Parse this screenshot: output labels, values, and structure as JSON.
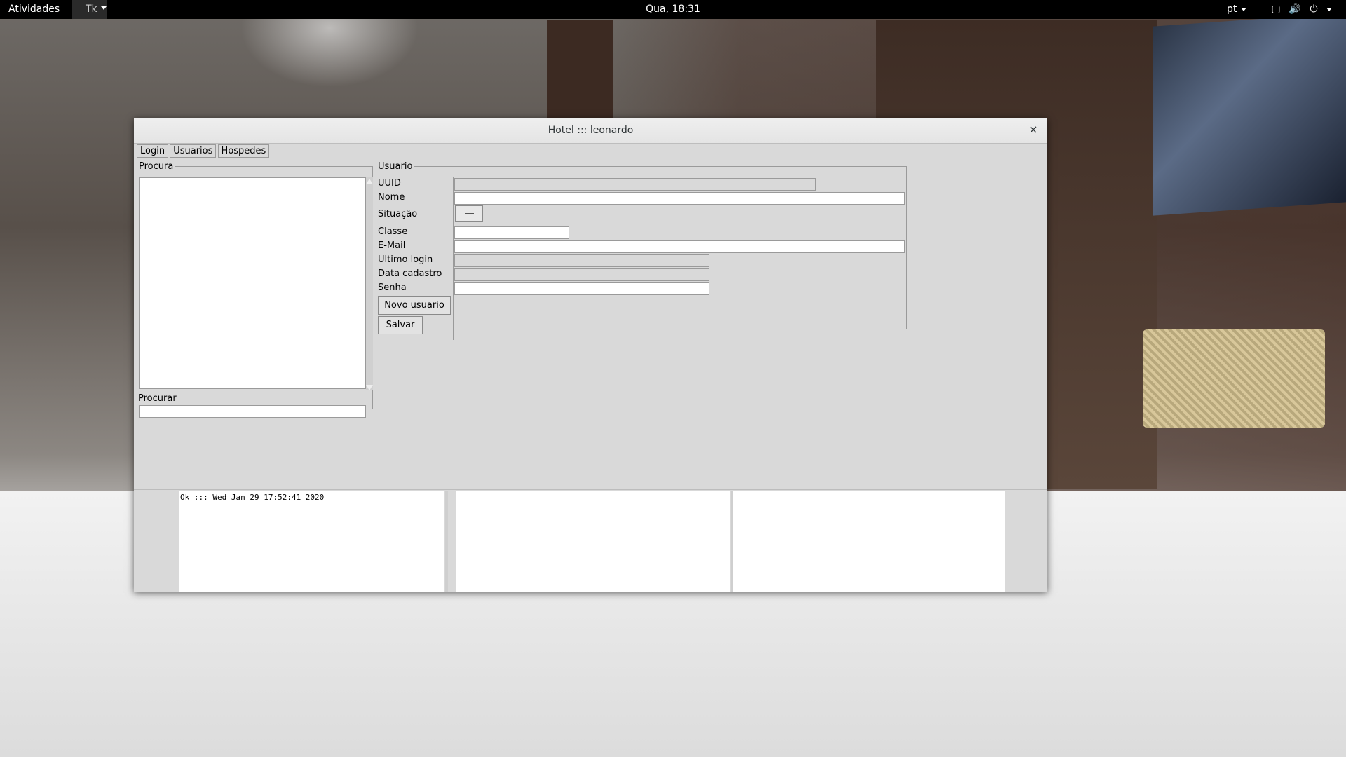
{
  "topbar": {
    "activities": "Atividades",
    "app_label": "Tk",
    "clock": "Qua, 18:31",
    "lang": "pt",
    "icons": [
      "window-icon",
      "volume-icon",
      "power-icon"
    ]
  },
  "window": {
    "title": "Hotel ::: leonardo",
    "close_glyph": "×"
  },
  "tabs": [
    "Login",
    "Usuarios",
    "Hospedes"
  ],
  "procura": {
    "legend": "Procura",
    "search_label": "Procurar",
    "search_value": ""
  },
  "usuario": {
    "legend": "Usuario",
    "fields": {
      "uuid": {
        "label": "UUID",
        "value": ""
      },
      "nome": {
        "label": "Nome",
        "value": ""
      },
      "situacao": {
        "label": "Situação"
      },
      "classe": {
        "label": "Classe",
        "value": ""
      },
      "email": {
        "label": "E-Mail",
        "value": ""
      },
      "ultimo_login": {
        "label": "Ultimo login",
        "value": ""
      },
      "data_cadastro": {
        "label": "Data cadastro",
        "value": ""
      },
      "senha": {
        "label": "Senha",
        "value": ""
      }
    },
    "buttons": {
      "novo": "Novo usuario",
      "salvar": "Salvar"
    }
  },
  "status": {
    "pane1": "Ok ::: Wed Jan 29 17:52:41 2020",
    "pane2": "",
    "pane3": ""
  }
}
